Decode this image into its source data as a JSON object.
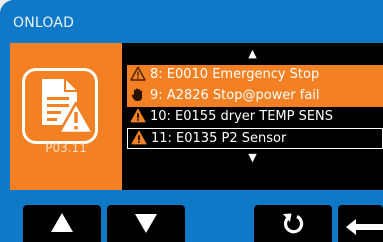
{
  "title": "ONLOAD",
  "left_panel": {
    "icon": "document-warning-icon",
    "code": "P03.11"
  },
  "list": {
    "scroll_up_icon": "▲",
    "scroll_down_icon": "▼",
    "items": [
      {
        "text": "8: E0010 Emergency Stop",
        "icon": "warning-outline-icon",
        "highlighted": true
      },
      {
        "text": "9: A2826 Stop@power fail",
        "icon": "hand-stop-icon",
        "highlighted": true
      },
      {
        "text": "10: E0155 dryer TEMP SENS",
        "icon": "warning-filled-icon",
        "highlighted": false
      },
      {
        "text": "11: E0135 P2 Sensor",
        "icon": "warning-filled-icon",
        "highlighted": false,
        "selected": true
      }
    ]
  },
  "buttons": [
    {
      "name": "up-button",
      "icon": "arrow-up-icon"
    },
    {
      "name": "down-button",
      "icon": "arrow-down-icon"
    },
    {
      "name": "refresh-button",
      "icon": "refresh-icon"
    },
    {
      "name": "back-button",
      "icon": "arrow-left-icon"
    }
  ],
  "colors": {
    "frame": "#0f79c7",
    "accent": "#f38022",
    "list_background": "#000000"
  }
}
